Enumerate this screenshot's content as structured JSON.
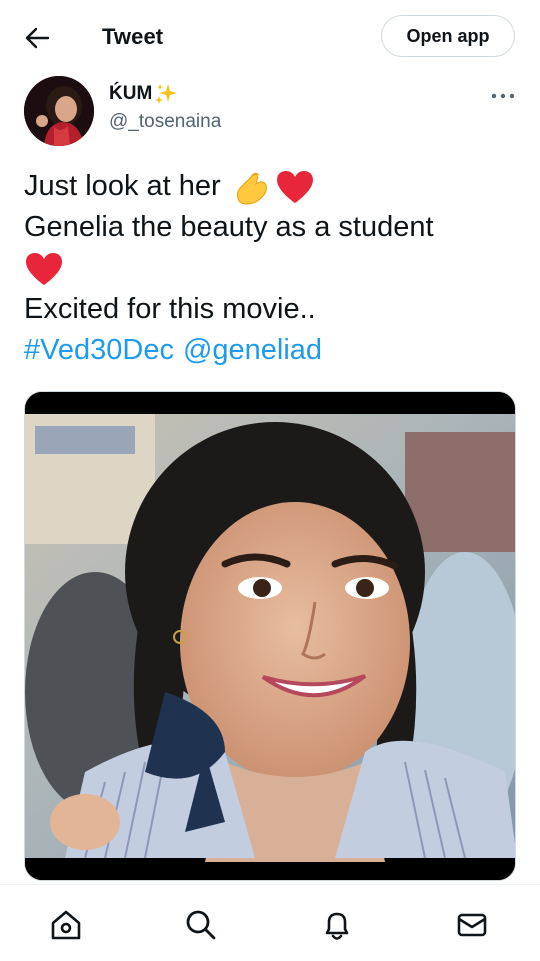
{
  "header": {
    "back_icon": "arrow-left-icon",
    "title": "Tweet",
    "open_app_label": "Open app"
  },
  "author": {
    "name": "ḰUM",
    "name_emoji": "sparkles-icon",
    "handle": "@_tosenaina",
    "avatar_icon": "avatar-photo",
    "more_icon": "more-dots-icon"
  },
  "tweet": {
    "line1": "Just look at her",
    "line2": "Genelia the beauty as a student",
    "line3": "Excited for this movie..",
    "hashtag": "#Ved30Dec",
    "mention": "@geneliad",
    "emojis": [
      "pinching-hand-icon",
      "red-heart-icon",
      "red-heart-icon"
    ]
  },
  "media": {
    "description_icon": "photo-icon"
  },
  "bottom_nav": {
    "items": [
      {
        "icon": "home-icon"
      },
      {
        "icon": "search-icon"
      },
      {
        "icon": "bell-icon"
      },
      {
        "icon": "mail-icon"
      }
    ]
  },
  "colors": {
    "link": "#1d9bf0",
    "text": "#0f1419",
    "secondary": "#536471",
    "border": "#cfd9de"
  }
}
